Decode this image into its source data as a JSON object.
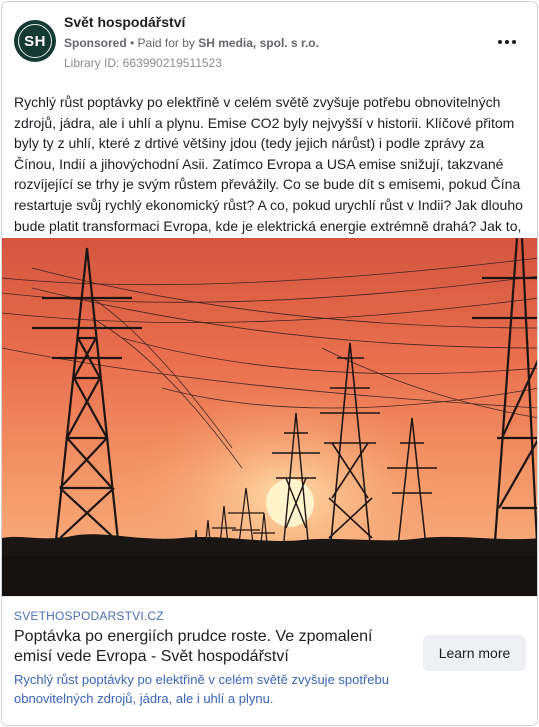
{
  "header": {
    "page_name": "Svět hospodářství",
    "avatar_initials": "SH",
    "sponsored": "Sponsored",
    "separator": " • ",
    "paid_for_prefix": "Paid for by ",
    "advertiser": "SH media, spol. s r.o.",
    "library_id": "Library ID: 663990219511523",
    "more_icon": "more-horizontal-icon"
  },
  "post": {
    "text": "Rychlý růst poptávky po elektřině v celém světě zvyšuje potřebu obnovitelných zdrojů, jádra, ale i uhlí a plynu. Emise CO2 byly nejvyšší v historii. Klíčové přitom byly ty z uhlí, které z drtivé většiny jdou (tedy jejich nárůst) i podle zprávy za Čínou, Indií a jihovýchodní Asii. Zatímco Evropa a USA emise snižují, takzvané rozvíjející se trhy je svým růstem převážily. Co se bude dít s emisemi, pokud Čína restartuje svůj rychlý ekonomický růst? A co, pokud urychlí růst v Indii? Jak dlouho bude platit transformaci Evropa, kde je elektrická energie extrémně drahá? Jak to, že s…"
  },
  "link": {
    "domain": "SVETHOSPODARSTVI.CZ",
    "title": "Poptávka po energiích prudce roste. Ve zpomalení emisí vede Evropa - Svět hospodářství",
    "description": "Rychlý růst poptávky po elektřině v celém světě zvyšuje spotřebu obnovitelných zdrojů, jádra, ale i uhlí a plynu.",
    "cta_label": "Learn more"
  },
  "colors": {
    "avatar_bg": "#153a33",
    "link_blue": "#3b66b8",
    "sky_top": "#d9614a",
    "sky_mid": "#f08f63",
    "sun": "#fff0c4"
  }
}
